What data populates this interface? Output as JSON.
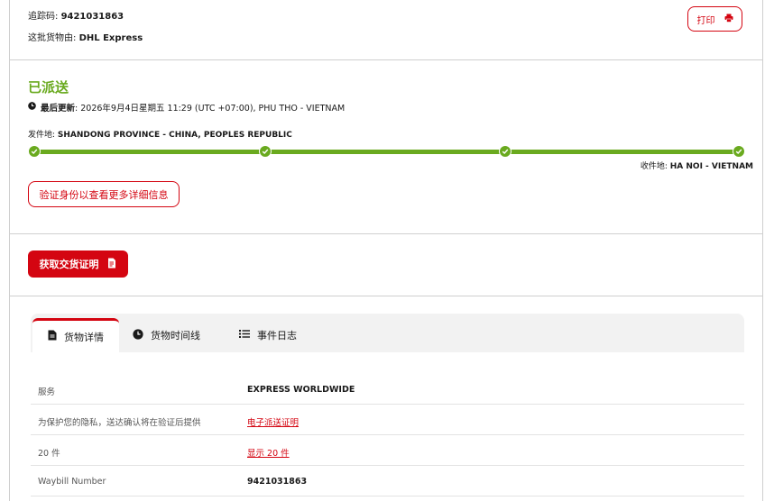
{
  "header": {
    "tracking_label": "追踪码:",
    "tracking_number": "9421031863",
    "carrier_label": "这批货物由:",
    "carrier_name": "DHL Express",
    "print_label": "打印",
    "print_icon": "printer-icon"
  },
  "status": {
    "title": "已派送",
    "updated_label": "最后更新",
    "updated_value": ": 2026年9月4日星期五 11:29 (UTC +07:00), PHU THO - VIETNAM",
    "origin_label": "发件地:",
    "origin_value": "SHANDONG PROVINCE - CHINA, PEOPLES REPUBLIC",
    "destination_label": "收件地:",
    "destination_value": "HA NOI - VIETNAM",
    "verify_button": "验证身份以查看更多详细信息",
    "accent_color": "#6aaa1f"
  },
  "proof": {
    "button_label": "获取交货证明",
    "button_color": "#d40511"
  },
  "tabs": [
    {
      "label": "货物详情",
      "icon": "document-icon",
      "active": true
    },
    {
      "label": "货物时间线",
      "icon": "clock-icon",
      "active": false
    },
    {
      "label": "事件日志",
      "icon": "list-icon",
      "active": false
    }
  ],
  "details": [
    {
      "key": "服务",
      "value": "EXPRESS WORLDWIDE",
      "type": "text"
    },
    {
      "key": "为保护您的隐私，送达确认将在验证后提供",
      "value": "电子派送证明",
      "type": "link"
    },
    {
      "key": "20 件",
      "value": "显示 20 件",
      "type": "link"
    },
    {
      "key": "Waybill Number",
      "value": "9421031863",
      "type": "text"
    }
  ]
}
